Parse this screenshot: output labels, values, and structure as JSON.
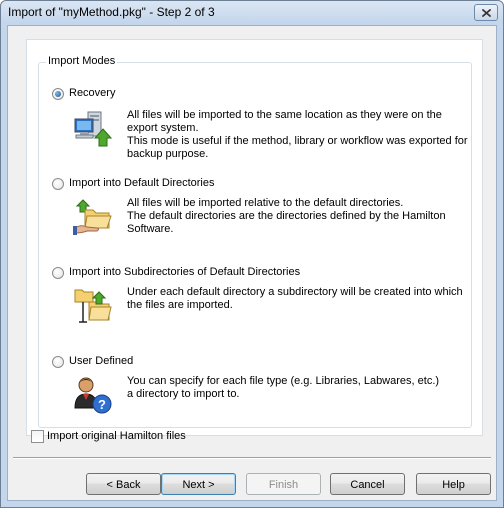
{
  "window": {
    "title": "Import of \"myMethod.pkg\" - Step 2 of 3"
  },
  "import_modes": {
    "group_label": "Import Modes",
    "options": [
      {
        "label": "Recovery",
        "checked": true,
        "icon": "computer-arrow-icon",
        "description_lines": [
          "All files will be imported to the same location as they were on the",
          "export system.",
          "This mode is useful if the method, library or workflow was exported for",
          "backup purpose."
        ]
      },
      {
        "label": "Import into Default Directories",
        "checked": false,
        "icon": "folder-hand-icon",
        "description_lines": [
          "All files will be imported relative to the default directories.",
          "The default directories are the directories defined by the Hamilton",
          "Software."
        ]
      },
      {
        "label": "Import into Subdirectories of Default Directories",
        "checked": false,
        "icon": "subfolder-icon",
        "description_lines": [
          "Under each default directory a subdirectory will be created into which",
          "the files are imported."
        ]
      },
      {
        "label": "User Defined",
        "checked": false,
        "icon": "user-help-icon",
        "description_lines": [
          "You can specify for each file type (e.g. Libraries, Labwares, etc.)",
          "a directory to import to."
        ]
      }
    ]
  },
  "import_original": {
    "label": "Import original Hamilton files",
    "checked": false
  },
  "buttons": {
    "back": "< Back",
    "next": "Next >",
    "finish": "Finish",
    "cancel": "Cancel",
    "help": "Help"
  }
}
